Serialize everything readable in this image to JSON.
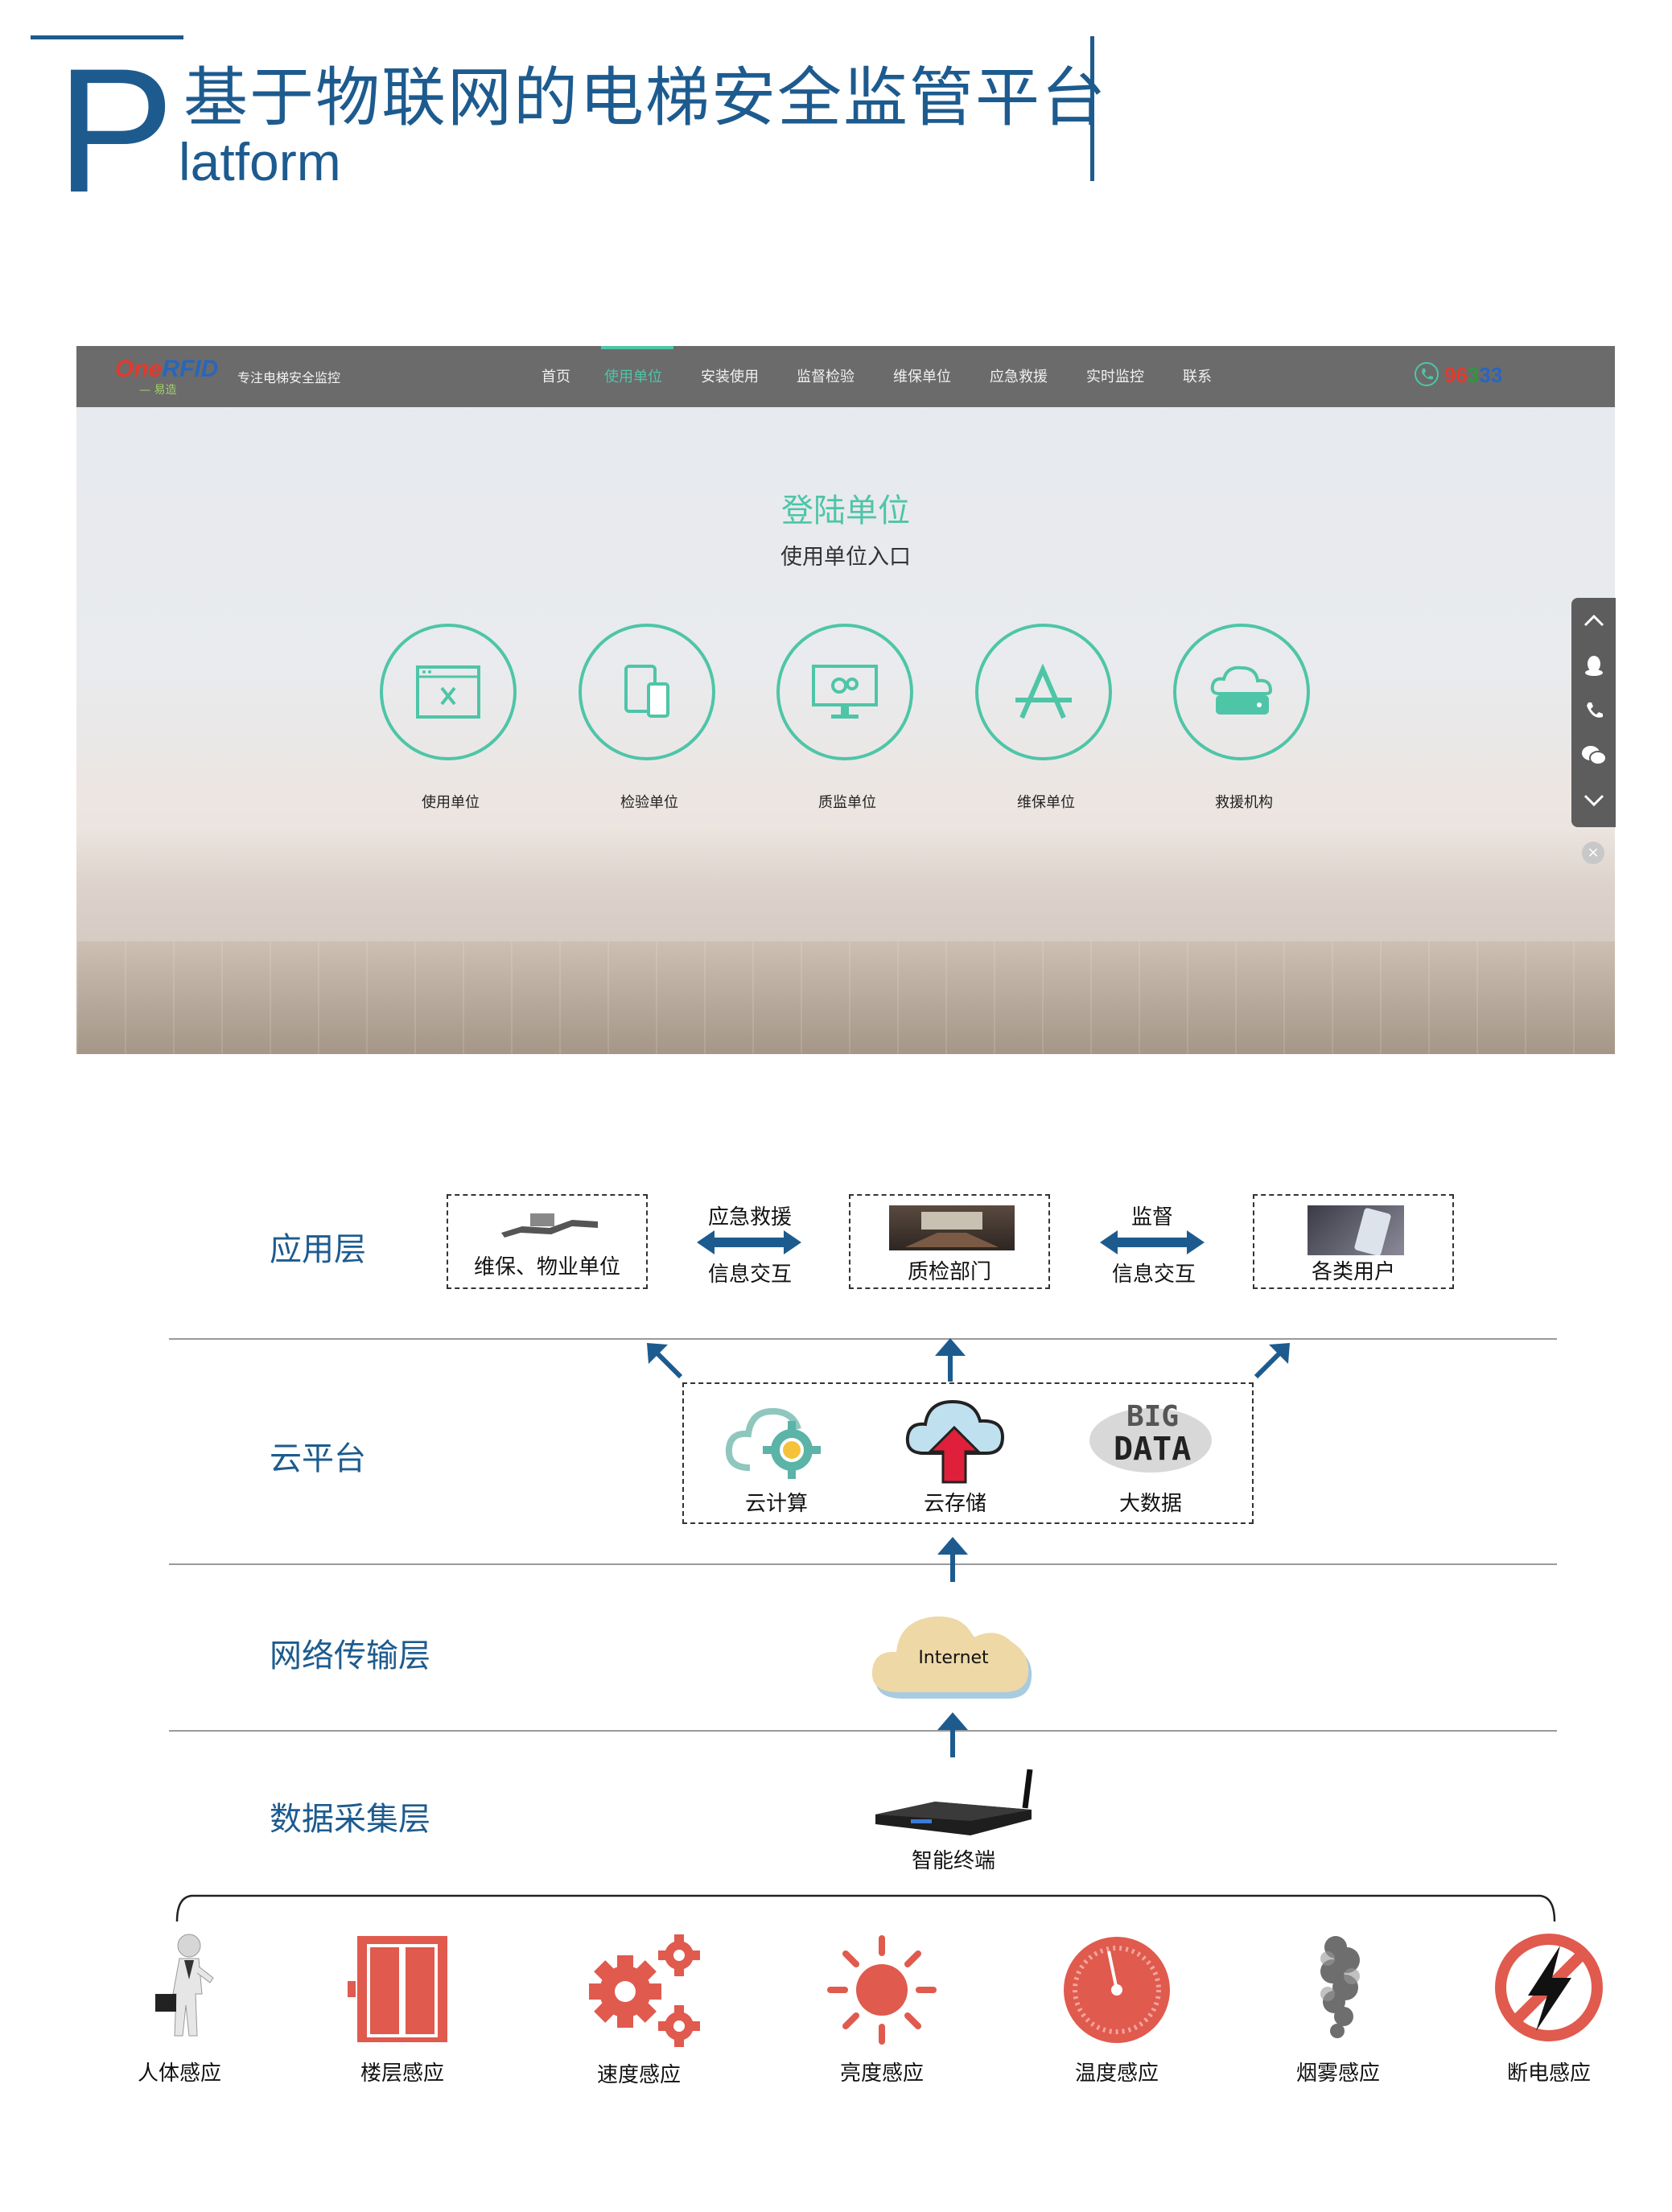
{
  "header": {
    "big_letter": "P",
    "title": "基于物联网的电梯安全监管平台",
    "subtitle": "latform"
  },
  "screenshot": {
    "logo_one": "One",
    "logo_rfid": "RFID",
    "logo_sub": "— 易造",
    "tagline": "专注电梯安全监控",
    "nav": [
      "首页",
      "使用单位",
      "安装使用",
      "监督检验",
      "维保单位",
      "应急救援",
      "实时监控",
      "联系"
    ],
    "nav_active": "使用单位",
    "phone_d1": "96",
    "phone_d2": "3",
    "phone_d3": "33",
    "login_title": "登陆单位",
    "login_subtitle": "使用单位入口",
    "units": [
      {
        "label": "使用单位",
        "icon": "browser-tools-icon"
      },
      {
        "label": "检验单位",
        "icon": "devices-icon"
      },
      {
        "label": "质监单位",
        "icon": "monitor-gears-icon"
      },
      {
        "label": "维保单位",
        "icon": "app-store-icon"
      },
      {
        "label": "救援机构",
        "icon": "cloud-server-icon"
      }
    ],
    "close_glyph": "×",
    "accent_color": "#4ec5a7"
  },
  "architecture": {
    "layers": {
      "app": "应用层",
      "cloud": "云平台",
      "network": "网络传输层",
      "data": "数据采集层"
    },
    "app_boxes": [
      "维保、物业单位",
      "质检部门",
      "各类用户"
    ],
    "arrow1_top": "应急救援",
    "arrow1_bottom": "信息交互",
    "arrow2_top": "监督",
    "arrow2_bottom": "信息交互",
    "cloud_items": [
      "云计算",
      "云存储",
      "大数据"
    ],
    "bigdata_big": "BIG",
    "bigdata_data": "DATA",
    "internet": "Internet",
    "terminal": "智能终端",
    "primary_color": "#1d5b8f",
    "sensor_color": "#e05a4e"
  },
  "sensors": [
    "人体感应",
    "楼层感应",
    "速度感应",
    "亮度感应",
    "温度感应",
    "烟雾感应",
    "断电感应"
  ]
}
